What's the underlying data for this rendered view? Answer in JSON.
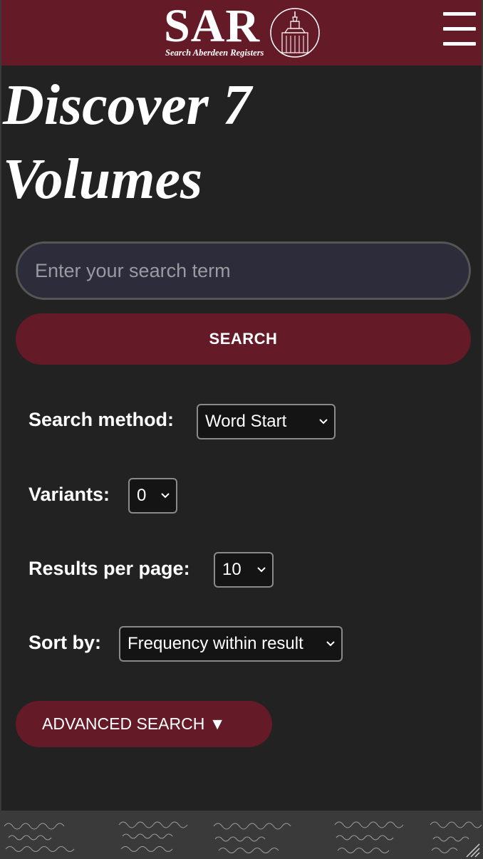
{
  "header": {
    "logo_text": "SAR",
    "logo_subtitle": "Search Aberdeen Registers",
    "menu_icon": "hamburger-menu-icon"
  },
  "main": {
    "title": "Discover 7 Volumes",
    "search_placeholder": "Enter your search term",
    "search_button_label": "SEARCH",
    "options": {
      "method_label": "Search method:",
      "method_value": "Word Start",
      "variants_label": "Variants:",
      "variants_value": "0",
      "per_page_label": "Results per page:",
      "per_page_value": "10",
      "sort_label": "Sort by:",
      "sort_value": "Frequency within result"
    },
    "advanced_label": "ADVANCED SEARCH ▼"
  },
  "colors": {
    "brand": "#651a28",
    "background": "#222222",
    "input_background": "#2c2c3a"
  }
}
